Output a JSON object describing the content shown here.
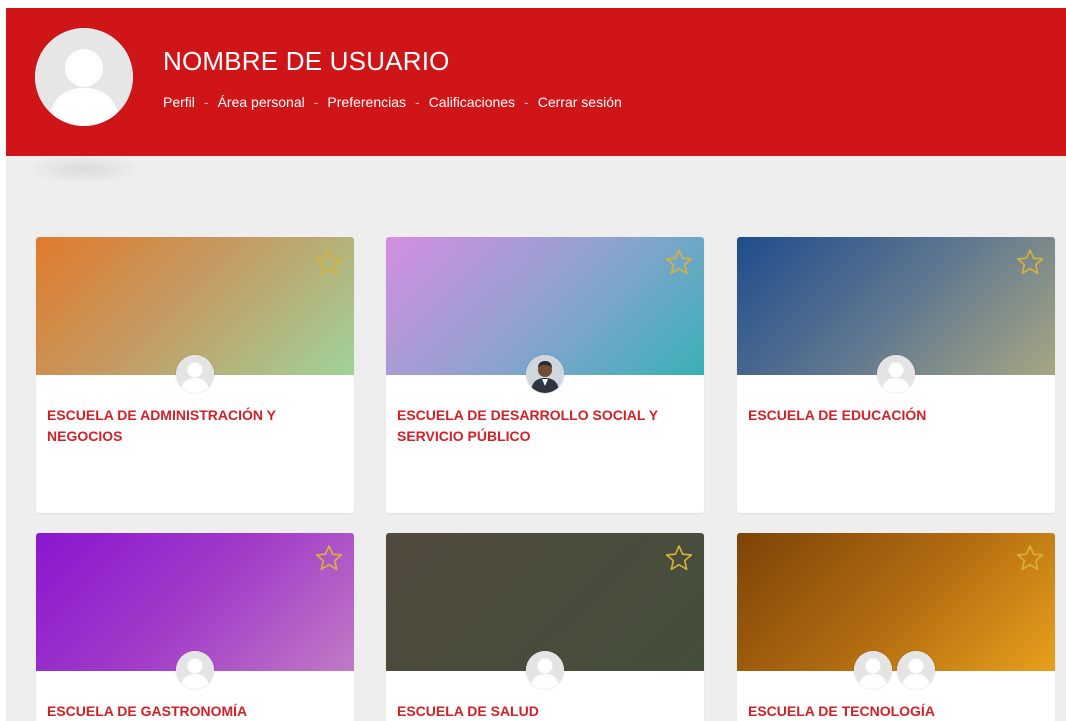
{
  "header": {
    "user_name": "NOMBRE DE USUARIO",
    "bg_color": "#cf1518",
    "nav": [
      {
        "label": "Perfil"
      },
      {
        "label": "Área personal"
      },
      {
        "label": "Preferencias"
      },
      {
        "label": "Calificaciones"
      },
      {
        "label": "Cerrar sesión"
      }
    ],
    "separator": "-"
  },
  "courses": [
    {
      "title": "ESCUELA DE ADMINISTRACIÓN Y NEGOCIOS",
      "gradient": [
        "#e07a2c",
        "#9fd39a"
      ],
      "teachers": [
        "default-avatar"
      ],
      "starred": false
    },
    {
      "title": "ESCUELA DE DESARROLLO SOCIAL Y SERVICIO PÚBLICO",
      "gradient": [
        "#d48ee0",
        "#38b0b8"
      ],
      "teachers": [
        "photo-avatar"
      ],
      "starred": false
    },
    {
      "title": "ESCUELA DE EDUCACIÓN",
      "gradient": [
        "#1f4d8c",
        "#a6a783"
      ],
      "teachers": [
        "default-avatar"
      ],
      "starred": false
    },
    {
      "title": "ESCUELA DE GASTRONOMÍA",
      "gradient": [
        "#8a16d0",
        "#c07bc6"
      ],
      "teachers": [
        "default-avatar"
      ],
      "starred": false
    },
    {
      "title": "ESCUELA DE SALUD",
      "gradient": [
        "#514a3d",
        "#444f3b"
      ],
      "teachers": [
        "default-avatar"
      ],
      "starred": false
    },
    {
      "title": "ESCUELA DE TECNOLOGÍA",
      "gradient": [
        "#7e4308",
        "#e8a01c"
      ],
      "teachers": [
        "default-avatar",
        "default-avatar"
      ],
      "starred": false
    }
  ],
  "colors": {
    "title_text": "#d0212a",
    "star_outline": "#d9b23a",
    "page_bg": "#eeeeee"
  }
}
